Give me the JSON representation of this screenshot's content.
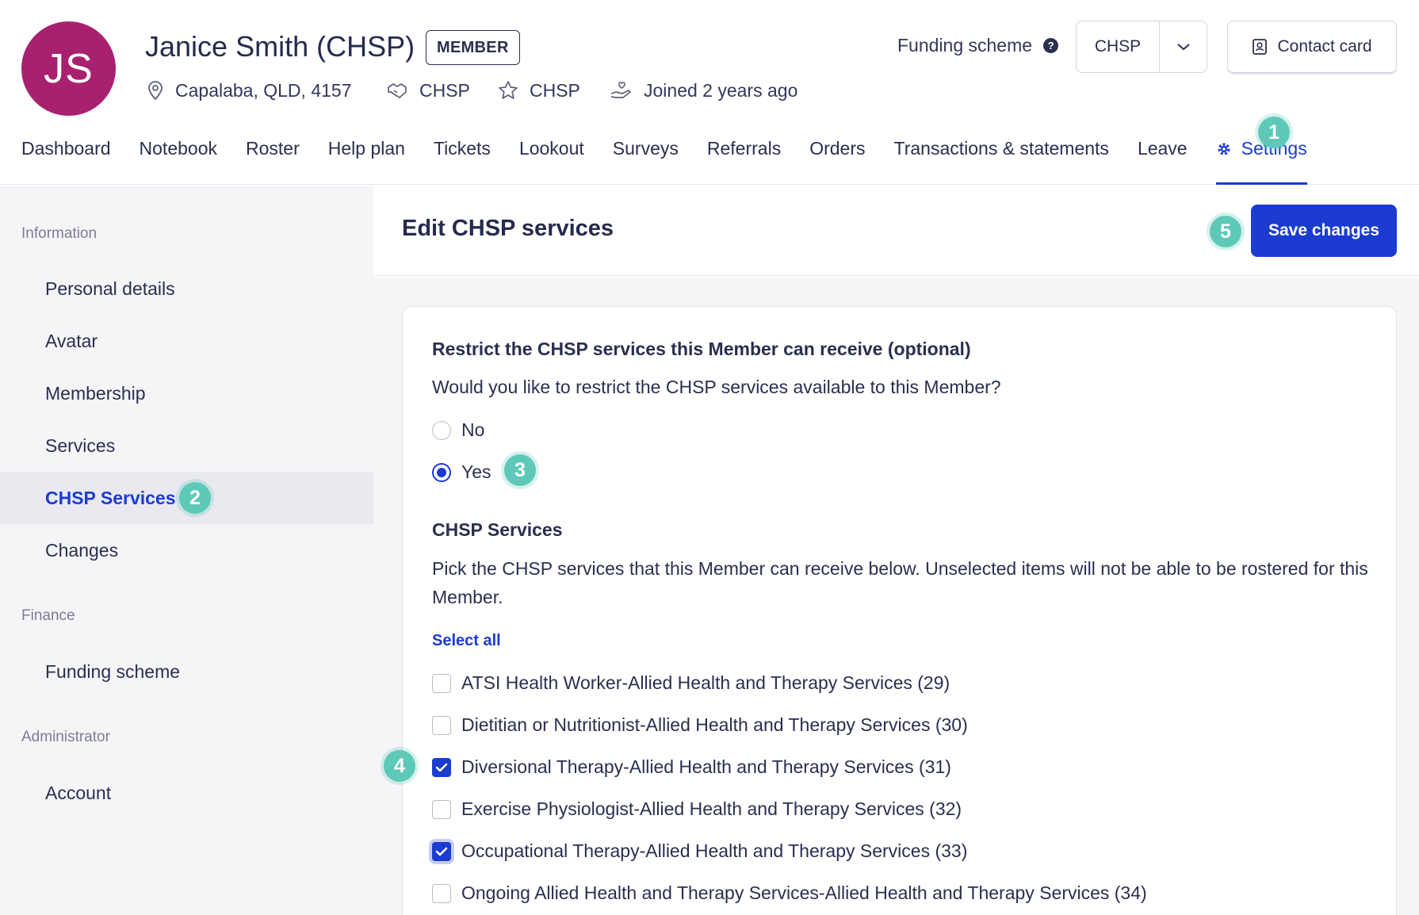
{
  "profile": {
    "initials": "JS",
    "name": "Janice Smith (CHSP)",
    "badge": "MEMBER",
    "location": "Capalaba, QLD, 4157",
    "scheme_a": "CHSP",
    "scheme_b": "CHSP",
    "joined": "Joined 2 years ago",
    "avatar_color": "#a8216f"
  },
  "funding": {
    "label": "Funding scheme",
    "help": "?",
    "selected": "CHSP"
  },
  "contact_card": "Contact card",
  "nav": {
    "items": [
      "Dashboard",
      "Notebook",
      "Roster",
      "Help plan",
      "Tickets",
      "Lookout",
      "Surveys",
      "Referrals",
      "Orders",
      "Transactions & statements",
      "Leave"
    ],
    "active": "Settings"
  },
  "steps": [
    "1",
    "2",
    "3",
    "4",
    "5"
  ],
  "sidebar": {
    "sections": [
      "Information",
      "Finance",
      "Administrator"
    ],
    "information": [
      "Personal details",
      "Avatar",
      "Membership",
      "Services",
      "CHSP Services",
      "Changes"
    ],
    "finance": [
      "Funding scheme"
    ],
    "administrator": [
      "Account"
    ],
    "active": "CHSP Services"
  },
  "main": {
    "title": "Edit CHSP services",
    "save": "Save changes",
    "restrict_title": "Restrict the CHSP services this Member can receive (optional)",
    "restrict_question": "Would you like to restrict the CHSP services available to this Member?",
    "options": [
      "No",
      "Yes"
    ],
    "selected_option": "Yes",
    "services_title": "CHSP Services",
    "services_text": "Pick the CHSP services that this Member can receive below. Unselected items will not be able to be rostered for this Member.",
    "select_all": "Select all",
    "services": [
      {
        "label": "ATSI Health Worker-Allied Health and Therapy Services (29)",
        "checked": false
      },
      {
        "label": "Dietitian or Nutritionist-Allied Health and Therapy Services (30)",
        "checked": false
      },
      {
        "label": "Diversional Therapy-Allied Health and Therapy Services (31)",
        "checked": true
      },
      {
        "label": "Exercise Physiologist-Allied Health and Therapy Services (32)",
        "checked": false
      },
      {
        "label": "Occupational Therapy-Allied Health and Therapy Services (33)",
        "checked": true
      },
      {
        "label": "Ongoing Allied Health and Therapy Services-Allied Health and Therapy Services (34)",
        "checked": false
      }
    ]
  },
  "colors": {
    "accent": "#1b3bd1",
    "step": "#5ec9b9",
    "text": "#2a2f4f"
  }
}
